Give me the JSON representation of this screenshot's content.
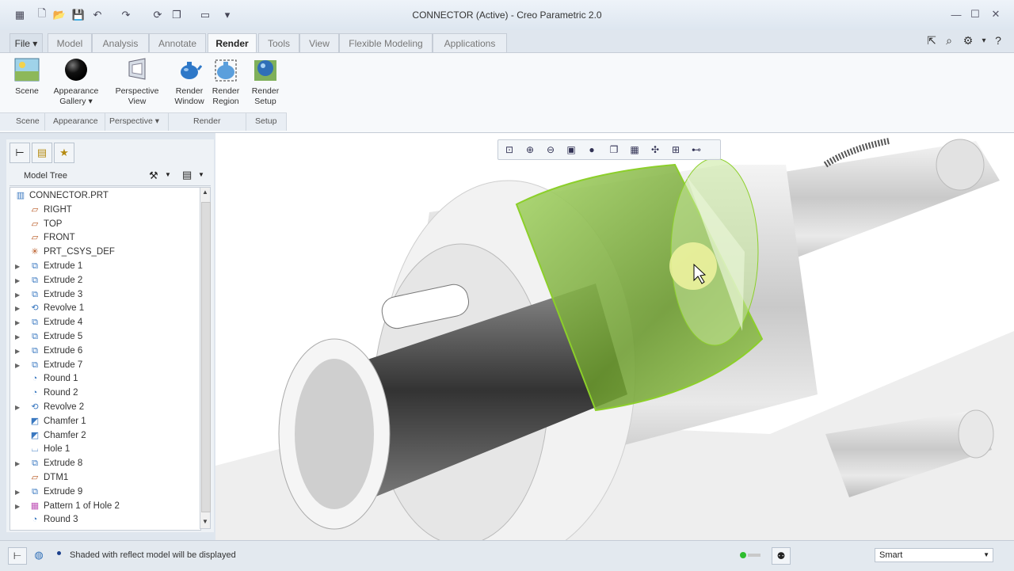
{
  "window": {
    "title": "CONNECTOR (Active) - Creo Parametric 2.0"
  },
  "tabs": [
    {
      "label": "File ▾"
    },
    {
      "label": "Model"
    },
    {
      "label": "Analysis"
    },
    {
      "label": "Annotate"
    },
    {
      "label": "Render"
    },
    {
      "label": "Tools"
    },
    {
      "label": "View"
    },
    {
      "label": "Flexible Modeling"
    },
    {
      "label": "Applications"
    }
  ],
  "ribbon": {
    "buttons": [
      {
        "label": "Scene"
      },
      {
        "label": "Appearance\nGallery ▾"
      },
      {
        "label": "Perspective\nView"
      },
      {
        "label": "Render\nWindow"
      },
      {
        "label": "Render\nRegion"
      },
      {
        "label": "Render\nSetup"
      }
    ],
    "groups": [
      {
        "label": "Scene"
      },
      {
        "label": "Appearance"
      },
      {
        "label": "Perspective ▾"
      },
      {
        "label": "Render"
      },
      {
        "label": "Setup"
      }
    ]
  },
  "model_tree": {
    "header": "Model Tree",
    "nodes": [
      {
        "label": "CONNECTOR.PRT",
        "icon": "part-icon",
        "expandable": false
      },
      {
        "label": "RIGHT",
        "icon": "datum-plane-icon",
        "expandable": false
      },
      {
        "label": "TOP",
        "icon": "datum-plane-icon",
        "expandable": false
      },
      {
        "label": "FRONT",
        "icon": "datum-plane-icon",
        "expandable": false
      },
      {
        "label": "PRT_CSYS_DEF",
        "icon": "csys-icon",
        "expandable": false
      },
      {
        "label": "Extrude 1",
        "icon": "extrude-icon",
        "expandable": true
      },
      {
        "label": "Extrude 2",
        "icon": "extrude-icon",
        "expandable": true
      },
      {
        "label": "Extrude 3",
        "icon": "extrude-icon",
        "expandable": true
      },
      {
        "label": "Revolve 1",
        "icon": "revolve-icon",
        "expandable": true
      },
      {
        "label": "Extrude 4",
        "icon": "extrude-icon",
        "expandable": true
      },
      {
        "label": "Extrude 5",
        "icon": "extrude-icon",
        "expandable": true
      },
      {
        "label": "Extrude 6",
        "icon": "extrude-icon",
        "expandable": true
      },
      {
        "label": "Extrude 7",
        "icon": "extrude-icon",
        "expandable": true
      },
      {
        "label": "Round 1",
        "icon": "round-icon",
        "expandable": false
      },
      {
        "label": "Round 2",
        "icon": "round-icon",
        "expandable": false
      },
      {
        "label": "Revolve 2",
        "icon": "revolve-icon",
        "expandable": true
      },
      {
        "label": "Chamfer 1",
        "icon": "chamfer-icon",
        "expandable": false
      },
      {
        "label": "Chamfer 2",
        "icon": "chamfer-icon",
        "expandable": false
      },
      {
        "label": "Hole 1",
        "icon": "hole-icon",
        "expandable": false
      },
      {
        "label": "Extrude 8",
        "icon": "extrude-icon",
        "expandable": true
      },
      {
        "label": "DTM1",
        "icon": "datum-plane-icon",
        "expandable": false
      },
      {
        "label": "Extrude 9",
        "icon": "extrude-icon",
        "expandable": true
      },
      {
        "label": "Pattern 1 of Hole 2",
        "icon": "pattern-icon",
        "expandable": true
      },
      {
        "label": "Round 3",
        "icon": "round-icon",
        "expandable": false
      }
    ]
  },
  "status": {
    "message": "Shaded with reflect model will be displayed",
    "filter_value": "Smart"
  },
  "colors": {
    "highlight": "#8ccf2a",
    "accent": "#2f6fb7"
  }
}
